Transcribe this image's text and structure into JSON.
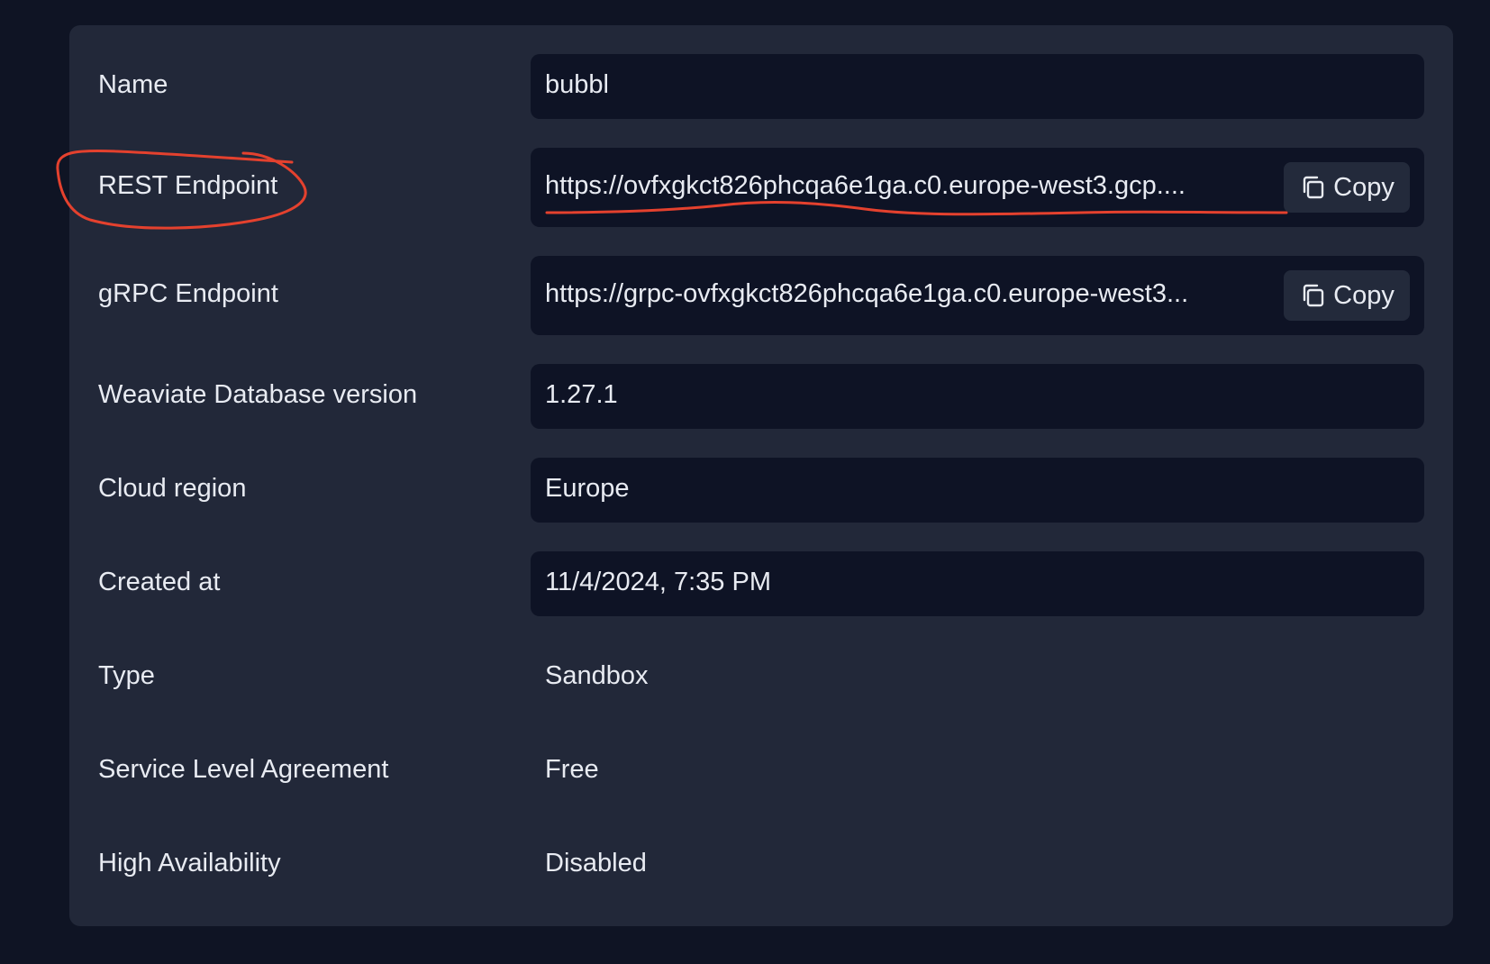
{
  "details": {
    "name": {
      "label": "Name",
      "value": "bubbl"
    },
    "rest_endpoint": {
      "label": "REST Endpoint",
      "value": "https://ovfxgkct826phcqa6e1ga.c0.europe-west3.gcp....",
      "copy_label": "Copy"
    },
    "grpc_endpoint": {
      "label": "gRPC Endpoint",
      "value": "https://grpc-ovfxgkct826phcqa6e1ga.c0.europe-west3...",
      "copy_label": "Copy"
    },
    "db_version": {
      "label": "Weaviate Database version",
      "value": "1.27.1"
    },
    "cloud_region": {
      "label": "Cloud region",
      "value": "Europe"
    },
    "created_at": {
      "label": "Created at",
      "value": "11/4/2024, 7:35 PM"
    },
    "type": {
      "label": "Type",
      "value": "Sandbox"
    },
    "sla": {
      "label": "Service Level Agreement",
      "value": "Free"
    },
    "high_availability": {
      "label": "High Availability",
      "value": "Disabled"
    }
  },
  "icons": {
    "copy": "copy-icon"
  },
  "colors": {
    "background": "#0f1424",
    "panel": "#222839",
    "field": "#0e1325",
    "annotation": "#e4412e"
  }
}
